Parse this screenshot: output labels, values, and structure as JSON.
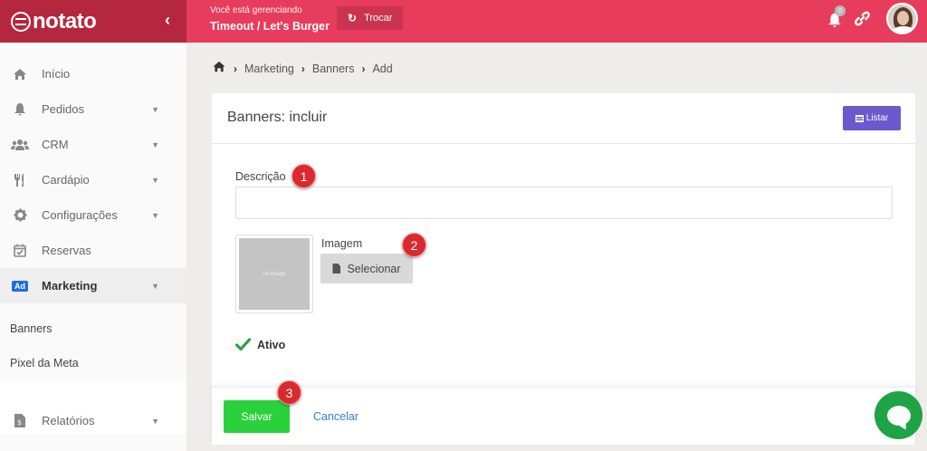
{
  "brand": {
    "name": "notato"
  },
  "topbar": {
    "context_caption": "Você está gerenciando",
    "context_name": "Timeout / Let's Burger",
    "switch_label": "Trocar",
    "notification_count": "0"
  },
  "sidebar": {
    "items": [
      {
        "label": "Início",
        "icon": "home-icon"
      },
      {
        "label": "Pedidos",
        "icon": "bell-icon"
      },
      {
        "label": "CRM",
        "icon": "users-icon"
      },
      {
        "label": "Cardápio",
        "icon": "utensils-icon"
      },
      {
        "label": "Configurações",
        "icon": "gear-icon"
      },
      {
        "label": "Reservas",
        "icon": "calendar-check-icon"
      },
      {
        "label": "Marketing",
        "icon": "ad-icon",
        "badge": "Ad"
      },
      {
        "label": "Relatórios",
        "icon": "report-icon"
      }
    ],
    "subitems": [
      {
        "label": "Banners"
      },
      {
        "label": "Pixel da Meta"
      }
    ]
  },
  "breadcrumb": [
    "Marketing",
    "Banners",
    "Add"
  ],
  "card": {
    "title": "Banners: incluir",
    "list_button": "Listar",
    "description_label": "Descrição",
    "description_value": "",
    "image_label": "Imagem",
    "image_placeholder": "no image",
    "select_button": "Selecionar",
    "active_label": "Ativo",
    "active_checked": true,
    "save_button": "Salvar",
    "cancel_link": "Cancelar"
  },
  "markers": [
    "1",
    "2",
    "3"
  ],
  "colors": {
    "brand_dark": "#b5263f",
    "topbar": "#e83c5c",
    "primary_button": "#6a5acd",
    "save_button": "#2bd13c",
    "marker": "#d92a2f",
    "chat": "#1ea345",
    "check": "#2e9e4a"
  }
}
